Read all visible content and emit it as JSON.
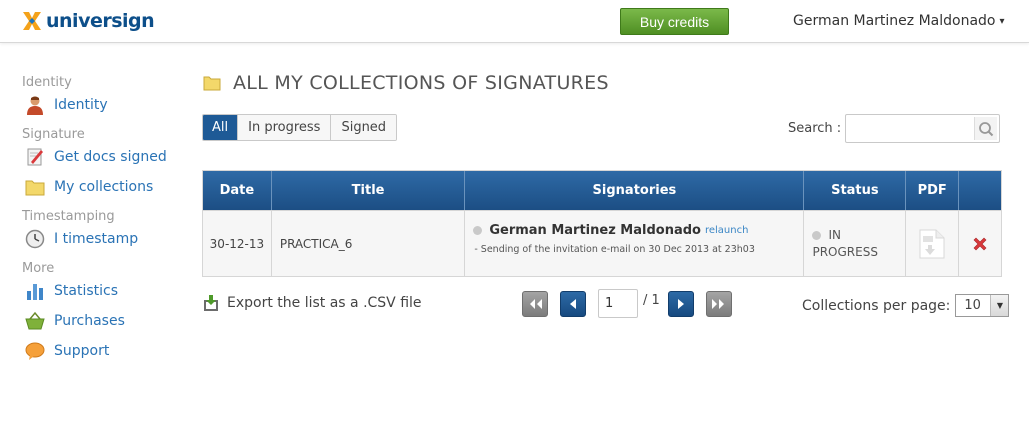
{
  "header": {
    "logo_text": "universign",
    "buy_label": "Buy credits",
    "user_name": "German Martinez Maldonado",
    "user_caret": "▾"
  },
  "sidebar": {
    "sections": [
      {
        "title": "Identity",
        "items": [
          {
            "label": "Identity",
            "icon": "user-icon"
          }
        ]
      },
      {
        "title": "Signature",
        "items": [
          {
            "label": "Get docs signed",
            "icon": "sign-doc-icon"
          },
          {
            "label": "My collections",
            "icon": "folder-icon"
          }
        ]
      },
      {
        "title": "Timestamping",
        "items": [
          {
            "label": "I timestamp",
            "icon": "clock-icon"
          }
        ]
      },
      {
        "title": "More",
        "items": [
          {
            "label": "Statistics",
            "icon": "bar-chart-icon"
          },
          {
            "label": "Purchases",
            "icon": "basket-icon"
          },
          {
            "label": "Support",
            "icon": "chat-bubble-icon"
          }
        ]
      }
    ]
  },
  "main": {
    "title": "ALL MY COLLECTIONS OF SIGNATURES",
    "filters": [
      "All",
      "In progress",
      "Signed"
    ],
    "active_filter": "All",
    "search_label": "Search :",
    "search_value": "",
    "table": {
      "columns": [
        "Date",
        "Title",
        "Signatories",
        "Status",
        "PDF",
        ""
      ],
      "rows": [
        {
          "date": "30-12-13",
          "title": "PRACTICA_6",
          "signatory": "German Martinez Maldonado",
          "relaunch": "relaunch",
          "note": "- Sending of the invitation e-mail on 30 Dec 2013 at 23h03",
          "status_line1": "IN",
          "status_line2": "PROGRESS"
        }
      ]
    },
    "export_label": "Export the list as a .CSV file",
    "pager": {
      "current": "1",
      "total": "/ 1"
    },
    "perpage_label": "Collections per page:",
    "perpage_value": "10"
  },
  "colors": {
    "brand": "#0d4f8a",
    "accent_green": "#5c9d2e",
    "table_header": "#1e5a96",
    "link": "#2a73b5",
    "delete": "#d9393c"
  }
}
